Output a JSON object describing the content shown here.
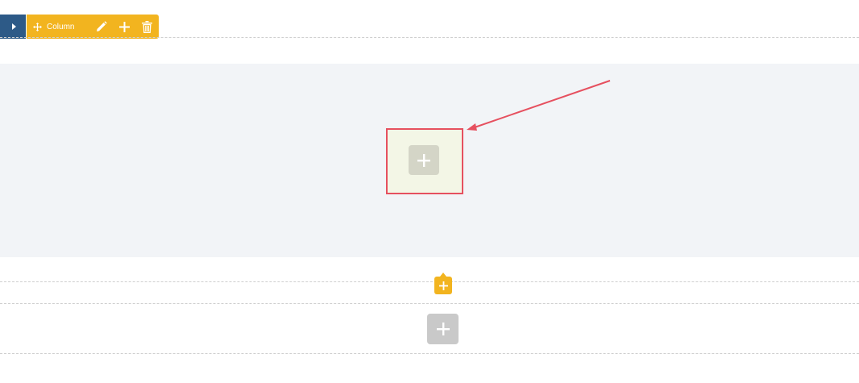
{
  "toolbar": {
    "row_handle_icon": "caret-right-icon",
    "column_label": "Column",
    "move_icon": "move-icon",
    "edit_icon": "pencil-icon",
    "add_icon": "plus-icon",
    "delete_icon": "trash-icon",
    "accent_color": "#f2b41f",
    "row_color": "#2d5a87"
  },
  "section": {
    "background_color": "#f2f4f7",
    "drop_zone_icon": "plus-icon",
    "highlight_color": "#e6505f"
  },
  "insert_button": {
    "icon": "plus-icon",
    "color": "#f2b41f"
  },
  "add_section_button": {
    "icon": "plus-icon",
    "color": "#c9c9c9"
  }
}
